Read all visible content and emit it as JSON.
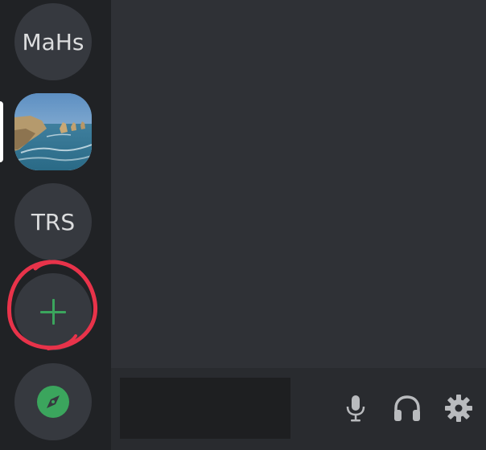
{
  "servers": [
    {
      "initials": "MaHs"
    },
    {
      "image": "coastal-cliffs-photo"
    },
    {
      "initials": "TRS"
    }
  ],
  "actions": {
    "add_server_icon": "plus-icon",
    "explore_icon": "compass-icon"
  },
  "user_controls": {
    "mic_icon": "microphone-icon",
    "headphones_icon": "headphones-icon",
    "settings_icon": "gear-icon"
  },
  "colors": {
    "rail_bg": "#202225",
    "main_bg": "#2f3136",
    "panel_bg": "#292b2f",
    "guild_bg": "#36393f",
    "accent_green": "#3ba55d",
    "annotation_red": "#e8334a",
    "icon_gray": "#b9bbbe"
  }
}
